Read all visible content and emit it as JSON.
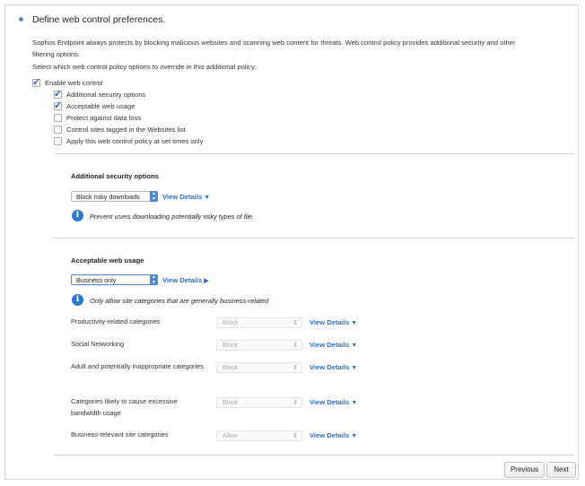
{
  "header": {
    "title": "Define web control preferences."
  },
  "intro": {
    "description": "Sophos Endpoint always protects by blocking malicious websites and scanning web content for threats. Web control policy provides additional security and other filtering options.",
    "prompt": "Select which web control policy options to override in this additional policy:"
  },
  "options": [
    {
      "label": "Enable web control",
      "checked": true
    },
    {
      "label": "Additional security options",
      "checked": true
    },
    {
      "label": "Acceptable web usage",
      "checked": true
    },
    {
      "label": "Protect against data loss",
      "checked": false
    },
    {
      "label": "Control sites tagged in the Websites list",
      "checked": false
    },
    {
      "label": "Apply this web control policy at set times only",
      "checked": false
    }
  ],
  "additional_security": {
    "heading": "Additional security options",
    "select_value": "Block risky downloads",
    "view_details": "View Details",
    "info": "Prevent users downloading potentially risky types of file."
  },
  "acceptable_use": {
    "heading": "Acceptable web usage",
    "select_value": "Business only",
    "view_details": "View Details",
    "info": "Only allow site categories that are generally business-related",
    "categories": [
      {
        "label": "Productivity-related categories",
        "action": "Block",
        "view_details": "View Details"
      },
      {
        "label": "Social Networking",
        "action": "Block",
        "view_details": "View Details"
      },
      {
        "label": "Adult and potentially inappropriate categories",
        "action": "Block",
        "view_details": "View Details"
      },
      {
        "label": "Categories likely to cause excessive bandwidth usage",
        "action": "Block",
        "view_details": "View Details"
      },
      {
        "label": "Business-relevant site categories",
        "action": "Allow",
        "view_details": "View Details"
      }
    ]
  },
  "footer": {
    "previous_label": "Previous",
    "next_label": "Next"
  },
  "colors": {
    "accent": "#2a6fc0",
    "info_icon": "#2b7ad0",
    "border": "#d6d6d6"
  }
}
